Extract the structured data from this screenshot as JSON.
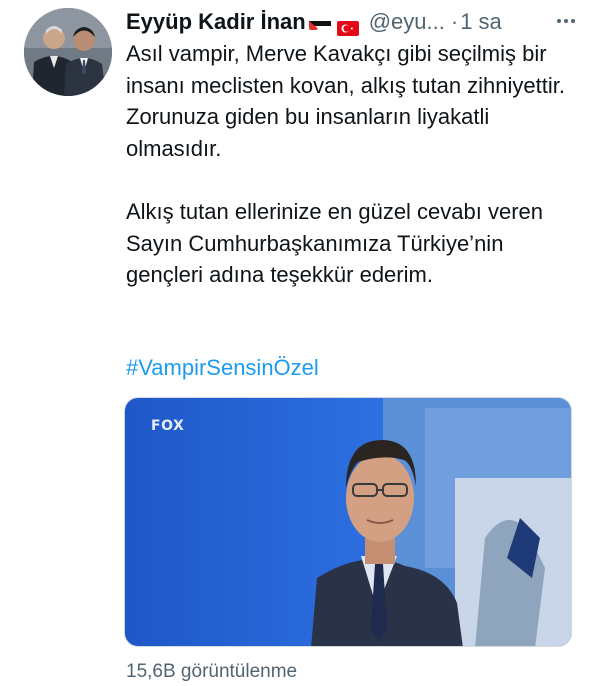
{
  "author": {
    "display_name": "Eyyüp Kadir İnan",
    "handle": "@eyu...",
    "separator": "·",
    "time": "1 sa"
  },
  "tweet": {
    "paragraph_1": "Asıl vampir, Merve Kavakçı gibi seçilmiş bir insanı meclisten kovan, alkış tutan zihniyettir. Zorunuza giden bu insanların liyakatli olmasıdır.",
    "paragraph_2": "Alkış tutan ellerinize en güzel cevabı veren Sayın Cumhurbaşkanımıza Türkiye’nin gençleri adına teşekkür ederim.",
    "hashtag": "#VampirSensinÖzel"
  },
  "media": {
    "logo_text": "FOX"
  },
  "footer": {
    "views": "15,6B görüntülenme"
  },
  "icons": {
    "more": "more-horizontal-icon",
    "flag_1": "palestine-flag-icon",
    "flag_2": "turkey-flag-icon"
  },
  "colors": {
    "link": "#1d9bf0",
    "secondary_text": "#536471",
    "primary_text": "#0f1419"
  }
}
